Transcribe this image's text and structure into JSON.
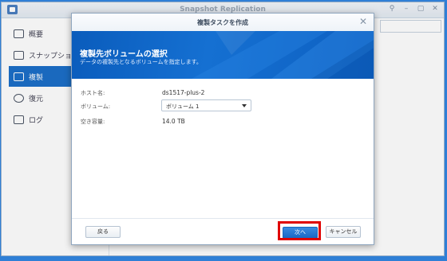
{
  "app": {
    "title": "Snapshot Replication",
    "controls": [
      "⚲",
      "–",
      "▢",
      "✕"
    ]
  },
  "sidebar": {
    "items": [
      {
        "label": "概要",
        "icon": "overview-icon"
      },
      {
        "label": "スナップショット",
        "icon": "camera-icon"
      },
      {
        "label": "複製",
        "icon": "replication-icon",
        "active": true
      },
      {
        "label": "復元",
        "icon": "restore-icon"
      },
      {
        "label": "ログ",
        "icon": "log-icon"
      }
    ]
  },
  "modal": {
    "title": "複製タスクを作成",
    "close": "✕",
    "banner": {
      "title": "複製先ボリュームの選択",
      "subtitle": "データの複製先となるボリュームを指定します。"
    },
    "form": {
      "host_label": "ホスト名:",
      "host_value": "ds1517-plus-2",
      "volume_label": "ボリューム:",
      "volume_value": "ボリューム 1",
      "free_label": "空き容量:",
      "free_value": "14.0 TB"
    },
    "footer": {
      "back": "戻る",
      "next": "次へ",
      "cancel": "キャンセル"
    }
  },
  "colors": {
    "accent": "#1c6fc9",
    "banner": "#0a5cbc",
    "highlight": "#e00000"
  }
}
